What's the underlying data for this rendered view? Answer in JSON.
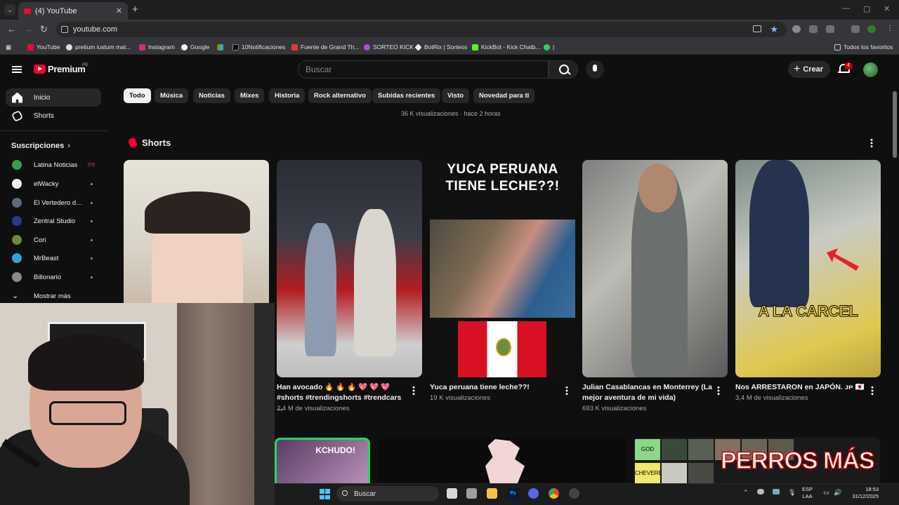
{
  "browser": {
    "tab_title": "(4) YouTube",
    "url": "youtube.com",
    "bookmarks": [
      "YouTube",
      "pretium iustum mat...",
      "Instagram",
      "Google",
      "",
      "10Notificaciones",
      "Fuente de Grand Th...",
      "SORTEO KICK",
      "BotRix | Sorteos",
      "KickBot - Kick Chatb...",
      "|"
    ],
    "all_bookmarks": "Todos los favoritos"
  },
  "yt": {
    "brand": "Premium",
    "country": "PE",
    "search_placeholder": "Buscar",
    "create_label": "Crear",
    "notif_count": "4"
  },
  "sidebar": {
    "home": "Inicio",
    "shorts": "Shorts",
    "subs_header": "Suscripciones",
    "subs": [
      {
        "name": "Latina Noticias",
        "live": true,
        "color": "#2ea34a"
      },
      {
        "name": "elWacky",
        "live": false,
        "color": "#f2f2f2"
      },
      {
        "name": "El Vertedero de ...",
        "live": false,
        "color": "#5d6a7a"
      },
      {
        "name": "Zentral Studio",
        "live": false,
        "color": "#2a3a8a"
      },
      {
        "name": "Cori",
        "live": false,
        "color": "#6b8a3a"
      },
      {
        "name": "MrBeast",
        "live": false,
        "color": "#3aa0d8"
      },
      {
        "name": "Billonario",
        "live": false,
        "color": "#8a8a8a"
      }
    ],
    "more": "Mostrar más"
  },
  "chips": [
    "Todo",
    "Música",
    "Noticias",
    "Mixes",
    "Historia",
    "Rock alternativo",
    "Subidas recientes",
    "Visto",
    "Novedad para ti"
  ],
  "top_meta": "36 K visualizaciones · hace 2 horas",
  "shorts_section": "Shorts",
  "shorts": [
    {
      "title_line1": "",
      "title_line2": "",
      "views": ""
    },
    {
      "title_line1": "Han avocado 🔥 🔥 🔥 💖 💖 💖",
      "title_line2": "#shorts #trendingshorts #trendcars ...",
      "views": "2,4 M de visualizaciones"
    },
    {
      "title_line1": "Yuca peruana tiene leche??!",
      "title_line2": "",
      "views": "19 K visualizaciones"
    },
    {
      "title_line1": "Julian Casablancas en Monterrey (La",
      "title_line2": "mejor aventura de mi vida)",
      "views": "693 K visualizaciones"
    },
    {
      "title_line1": "Nos ARRESTARON en JAPÓN. ᴊᴘ 🇯🇵",
      "title_line2": "",
      "views": "3,4 M de visualizaciones"
    }
  ],
  "thumb_text": {
    "yuca": "YUCA PERUANA TIENE LECHE??!",
    "carcel": "A LA CARCEL",
    "kchudo": "KCHUDO!",
    "perros": "PERROS MÁS",
    "god": "GOD",
    "chevere": "CHEVERE"
  },
  "taskbar": {
    "search": "Buscar",
    "lang1": "ESP",
    "lang2": "LAA",
    "time": "18:53",
    "date": "31/12/2025"
  }
}
